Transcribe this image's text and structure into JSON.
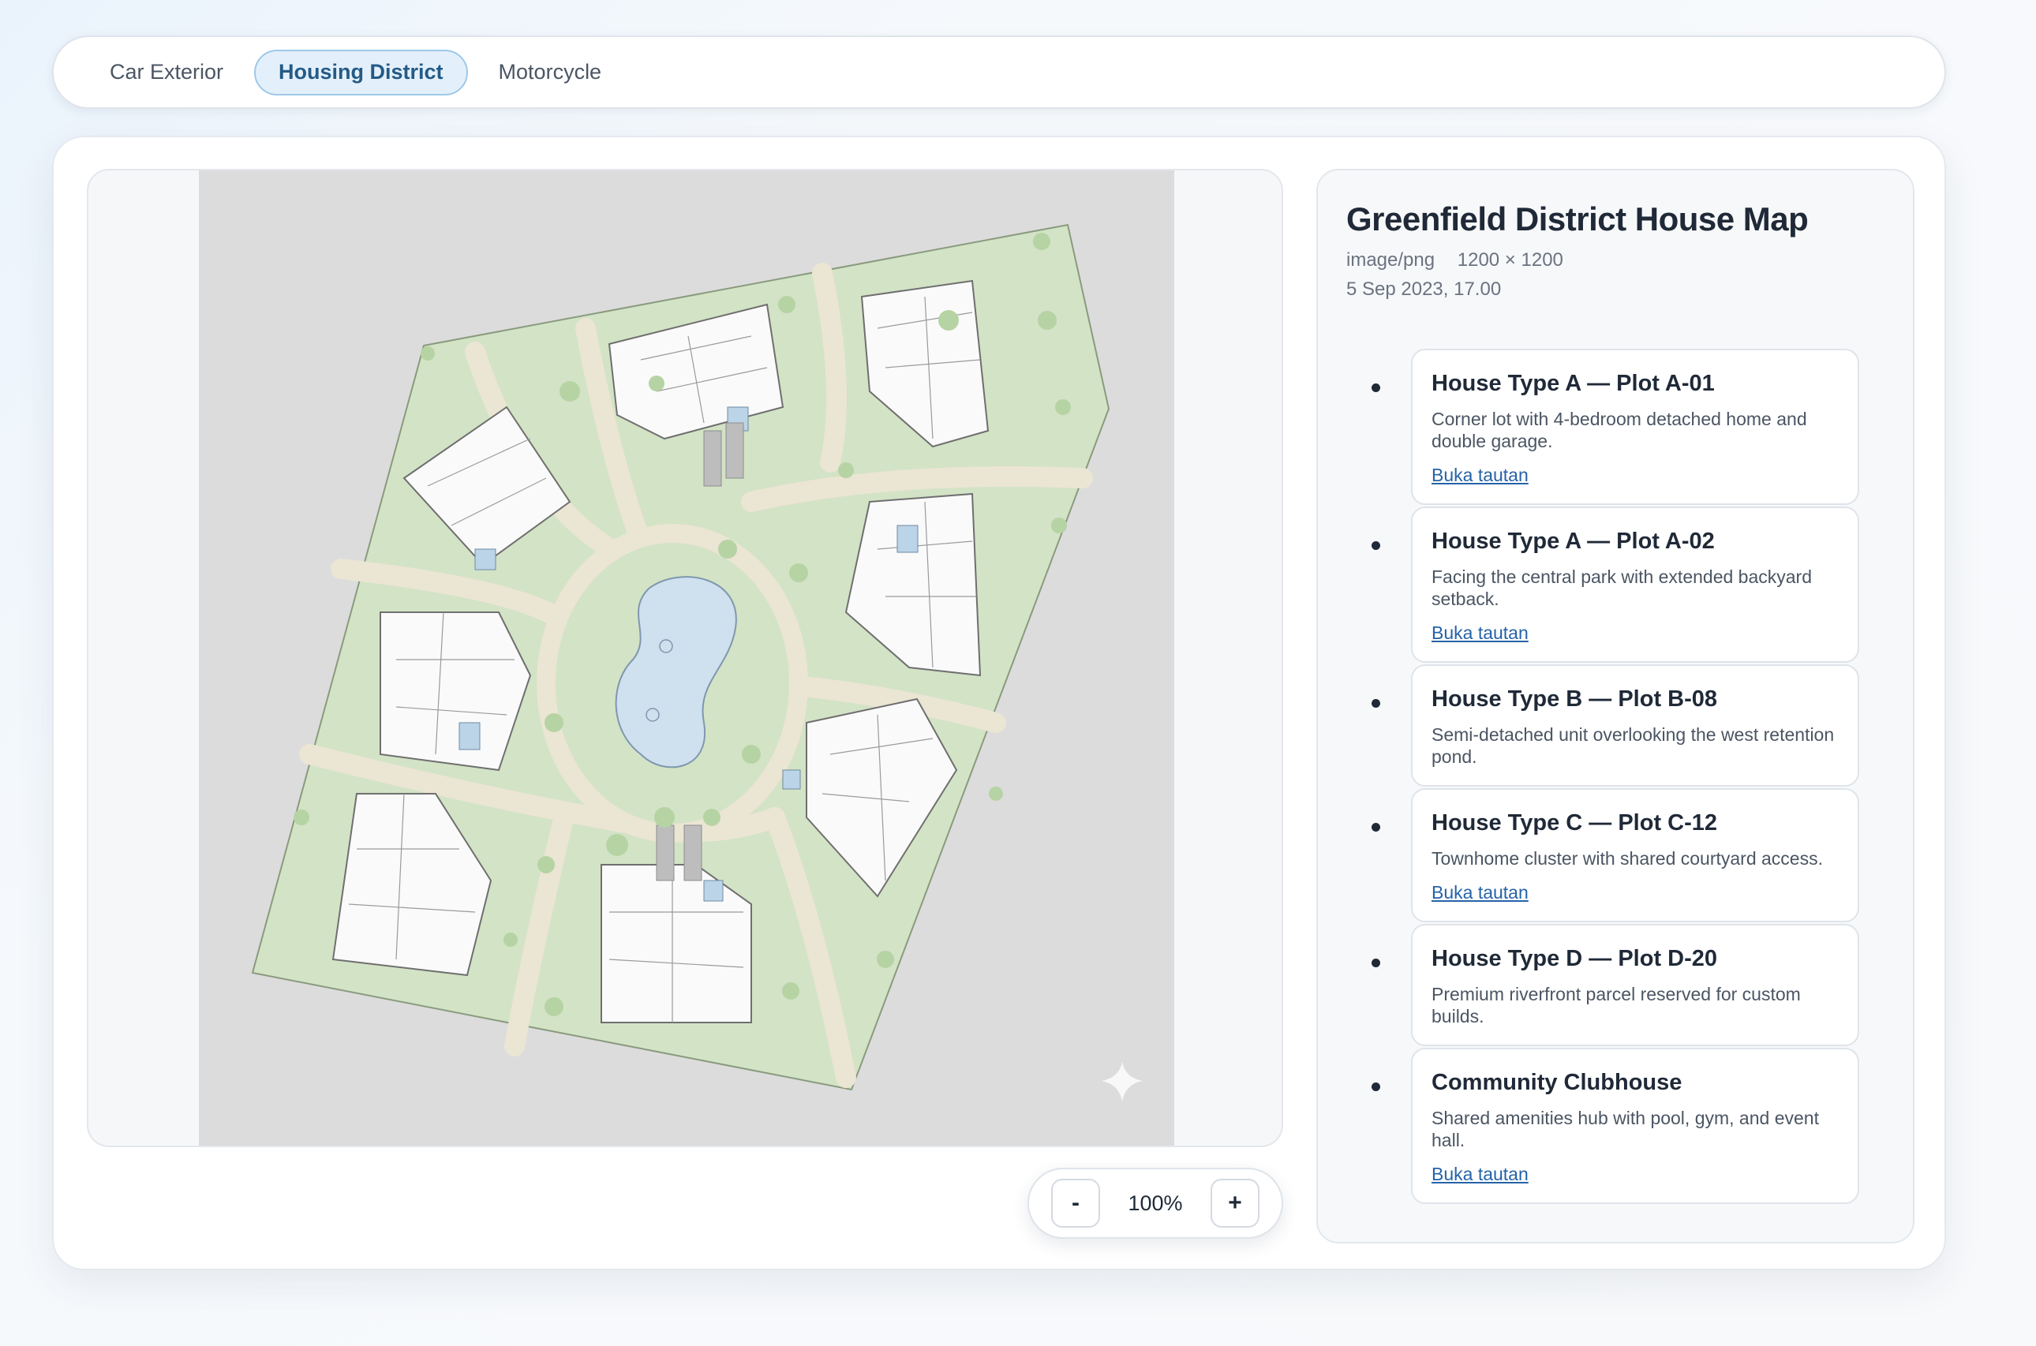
{
  "tabs": [
    {
      "label": "Car Exterior",
      "active": false
    },
    {
      "label": "Housing District",
      "active": true
    },
    {
      "label": "Motorcycle",
      "active": false
    }
  ],
  "viewer": {
    "zoom_out_label": "-",
    "zoom_value": "100%",
    "zoom_in_label": "+"
  },
  "info": {
    "title": "Greenfield District House Map",
    "mime": "image/png",
    "dimensions": "1200 × 1200",
    "date": "5 Sep 2023, 17.00"
  },
  "items": [
    {
      "title": "House Type A — Plot A-01",
      "desc": "Corner lot with 4-bedroom detached home and double garage.",
      "link": "Buka tautan"
    },
    {
      "title": "House Type A — Plot A-02",
      "desc": "Facing the central park with extended backyard setback.",
      "link": "Buka tautan"
    },
    {
      "title": "House Type B — Plot B-08",
      "desc": "Semi-detached unit overlooking the west retention pond.",
      "link": ""
    },
    {
      "title": "House Type C — Plot C-12",
      "desc": "Townhome cluster with shared courtyard access.",
      "link": "Buka tautan"
    },
    {
      "title": "House Type D — Plot D-20",
      "desc": "Premium riverfront parcel reserved for custom builds.",
      "link": ""
    },
    {
      "title": "Community Clubhouse",
      "desc": "Shared amenities hub with pool, gym, and event hall.",
      "link": "Buka tautan"
    }
  ],
  "colors": {
    "accent": "#2563a8",
    "active_tab_bg": "#e3f0fb",
    "map_lot": "#d3e3c6",
    "map_road": "#ece6d6",
    "map_pond": "#cfe0ee"
  }
}
